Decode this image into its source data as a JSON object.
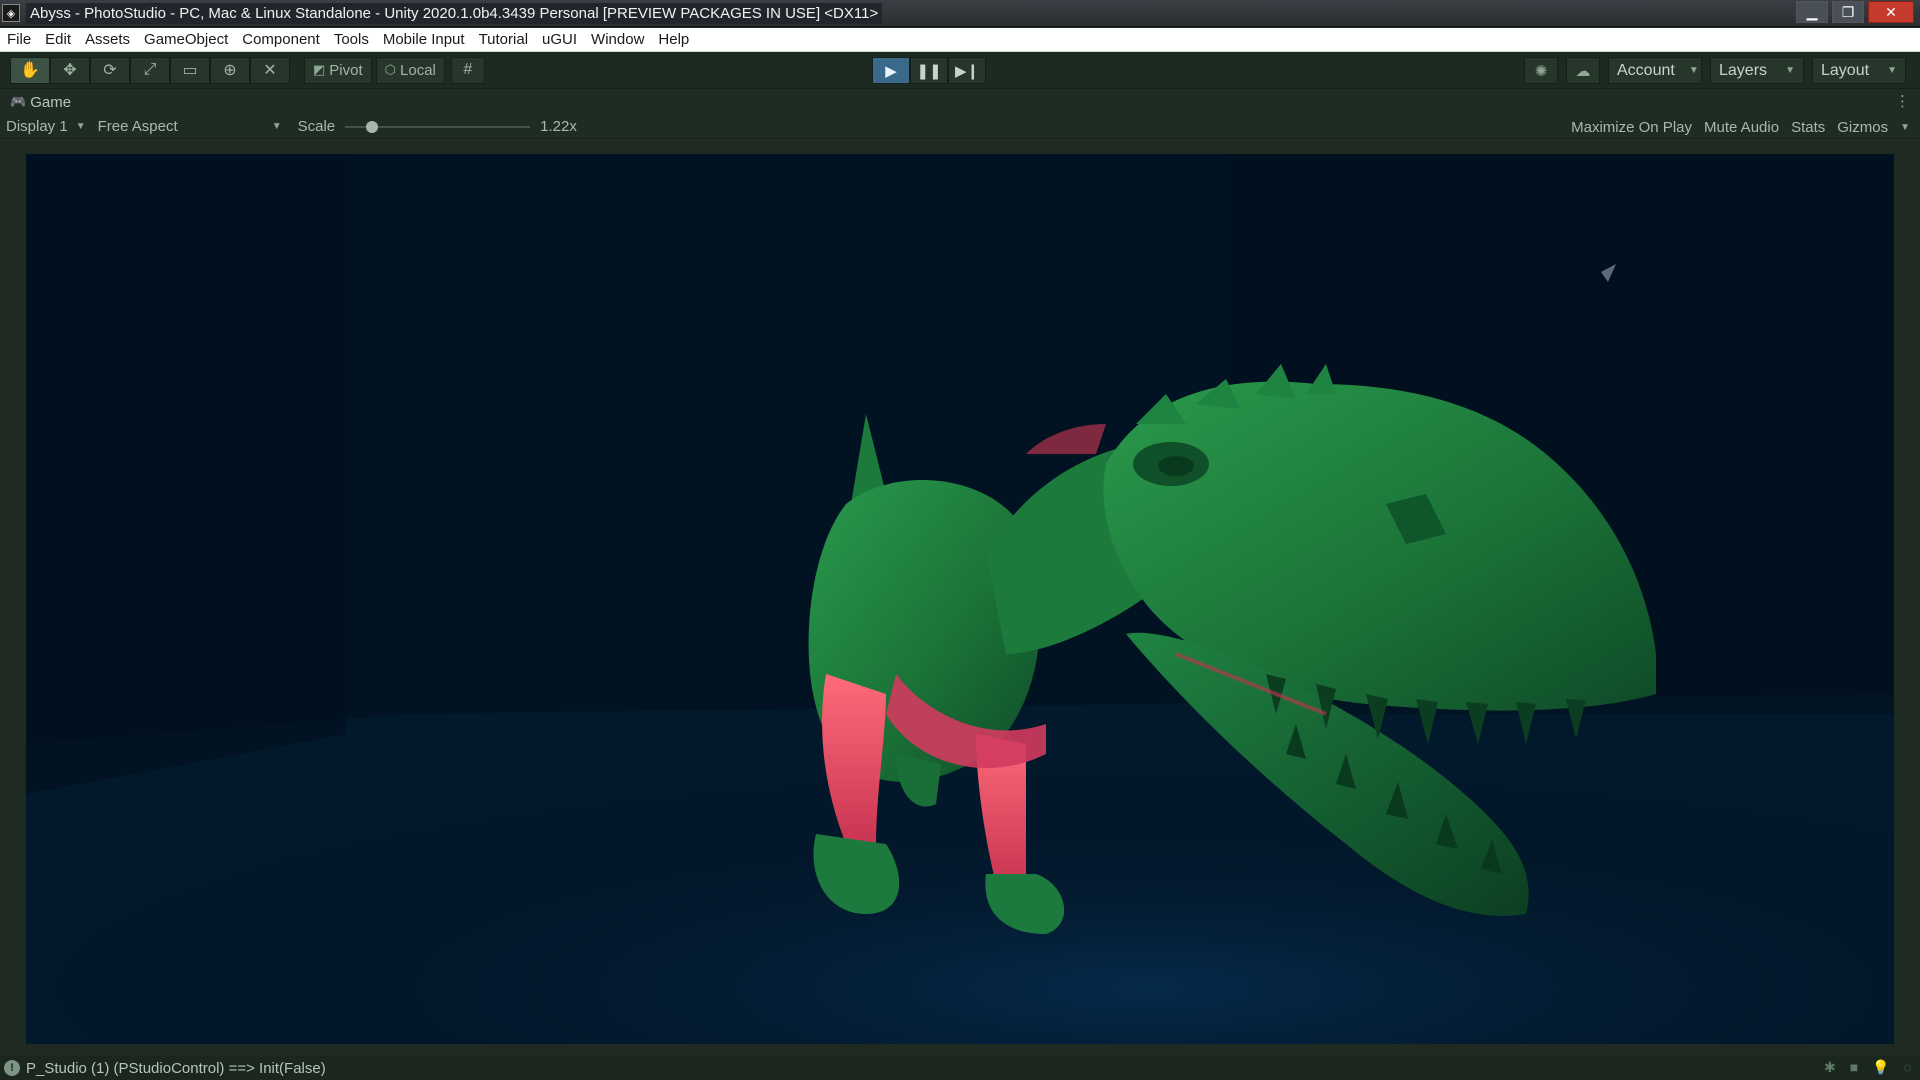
{
  "window": {
    "title": "Abyss - PhotoStudio - PC, Mac & Linux Standalone - Unity 2020.1.0b4.3439 Personal [PREVIEW PACKAGES IN USE] <DX11>",
    "controls": [
      "minimize",
      "maximize",
      "close"
    ]
  },
  "menu": {
    "items": [
      "File",
      "Edit",
      "Assets",
      "GameObject",
      "Component",
      "Tools",
      "Mobile Input",
      "Tutorial",
      "uGUI",
      "Window",
      "Help"
    ]
  },
  "toolbar": {
    "tools": [
      {
        "icon": "hand-icon"
      },
      {
        "icon": "move-icon"
      },
      {
        "icon": "rotate-icon"
      },
      {
        "icon": "scale-icon"
      },
      {
        "icon": "rect-icon"
      },
      {
        "icon": "transform-icon"
      },
      {
        "icon": "custom-tool-icon"
      }
    ],
    "pivot_label": "Pivot",
    "local_label": "Local",
    "account_label": "Account",
    "layers_label": "Layers",
    "layout_label": "Layout"
  },
  "game_tab": {
    "label": "Game"
  },
  "game_controls": {
    "display": "Display 1",
    "aspect": "Free Aspect",
    "scale_label": "Scale",
    "scale_value": "1.22x",
    "scale_fraction": 0.12,
    "maximize_on_play": "Maximize On Play",
    "mute_audio": "Mute Audio",
    "stats": "Stats",
    "gizmos": "Gizmos"
  },
  "status": {
    "message": "P_Studio (1) (PStudioControl) ==> Init(False)"
  },
  "colors": {
    "play_active": "#3a6a8a",
    "scene_green": "#1f7a3c",
    "scene_pink": "#ff5a6e",
    "scene_bg": "#021322"
  }
}
